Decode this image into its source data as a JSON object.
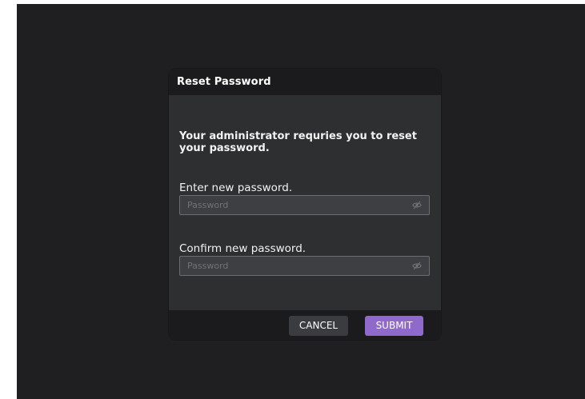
{
  "dialog": {
    "title": "Reset Password",
    "notice": "Your administrator requries you to reset your password.",
    "new_password": {
      "label": "Enter new password.",
      "placeholder": "Password",
      "value": "",
      "toggle_icon": "eye-slash-icon"
    },
    "confirm_password": {
      "label": "Confirm new password.",
      "placeholder": "Password",
      "value": "",
      "toggle_icon": "eye-slash-icon"
    },
    "buttons": {
      "cancel": "CANCEL",
      "submit": "SUBMIT"
    }
  },
  "colors": {
    "background": "#1f1f21",
    "dialog_body": "#2d2f31",
    "dialog_header": "#1b1b1d",
    "input_background": "#3d3f43",
    "accent": "#9069cc"
  }
}
